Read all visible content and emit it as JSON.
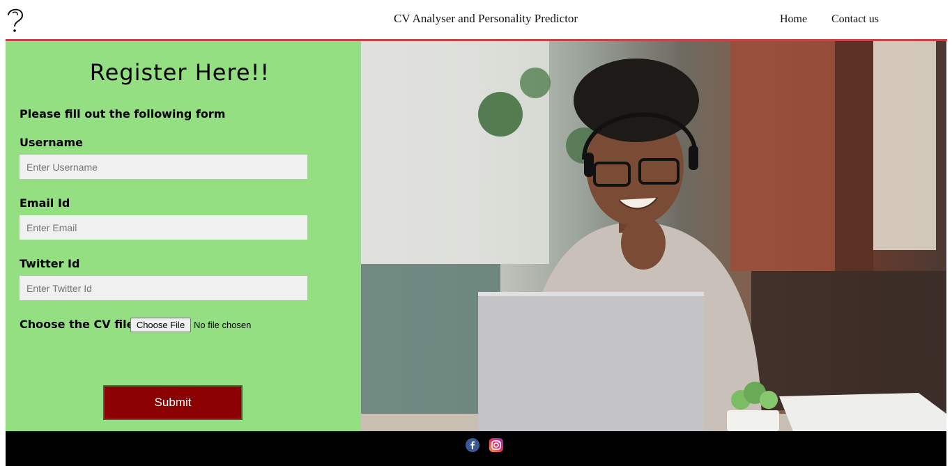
{
  "header": {
    "title": "CV Analyser and Personality Predictor",
    "nav": {
      "home": "Home",
      "contact": "Contact us"
    },
    "accent_color": "#c9434b"
  },
  "form": {
    "title": "Register Here!!",
    "subtitle": "Please fill out the following form",
    "username": {
      "label": "Username",
      "placeholder": "Enter Username",
      "value": ""
    },
    "email": {
      "label": "Email Id",
      "placeholder": "Enter Email",
      "value": ""
    },
    "twitter": {
      "label": "Twitter Id",
      "placeholder": "Enter Twitter Id",
      "value": ""
    },
    "cv_file": {
      "label": "Choose the CV file:",
      "button": "Choose File",
      "status": "No file chosen"
    },
    "submit": "Submit",
    "panel_color": "#93df81",
    "submit_color": "#8b0000"
  },
  "hero": {
    "icon": "photo-woman-laptop-headset"
  },
  "footer": {
    "icons": [
      "facebook-icon",
      "instagram-icon"
    ],
    "background": "#000000"
  }
}
